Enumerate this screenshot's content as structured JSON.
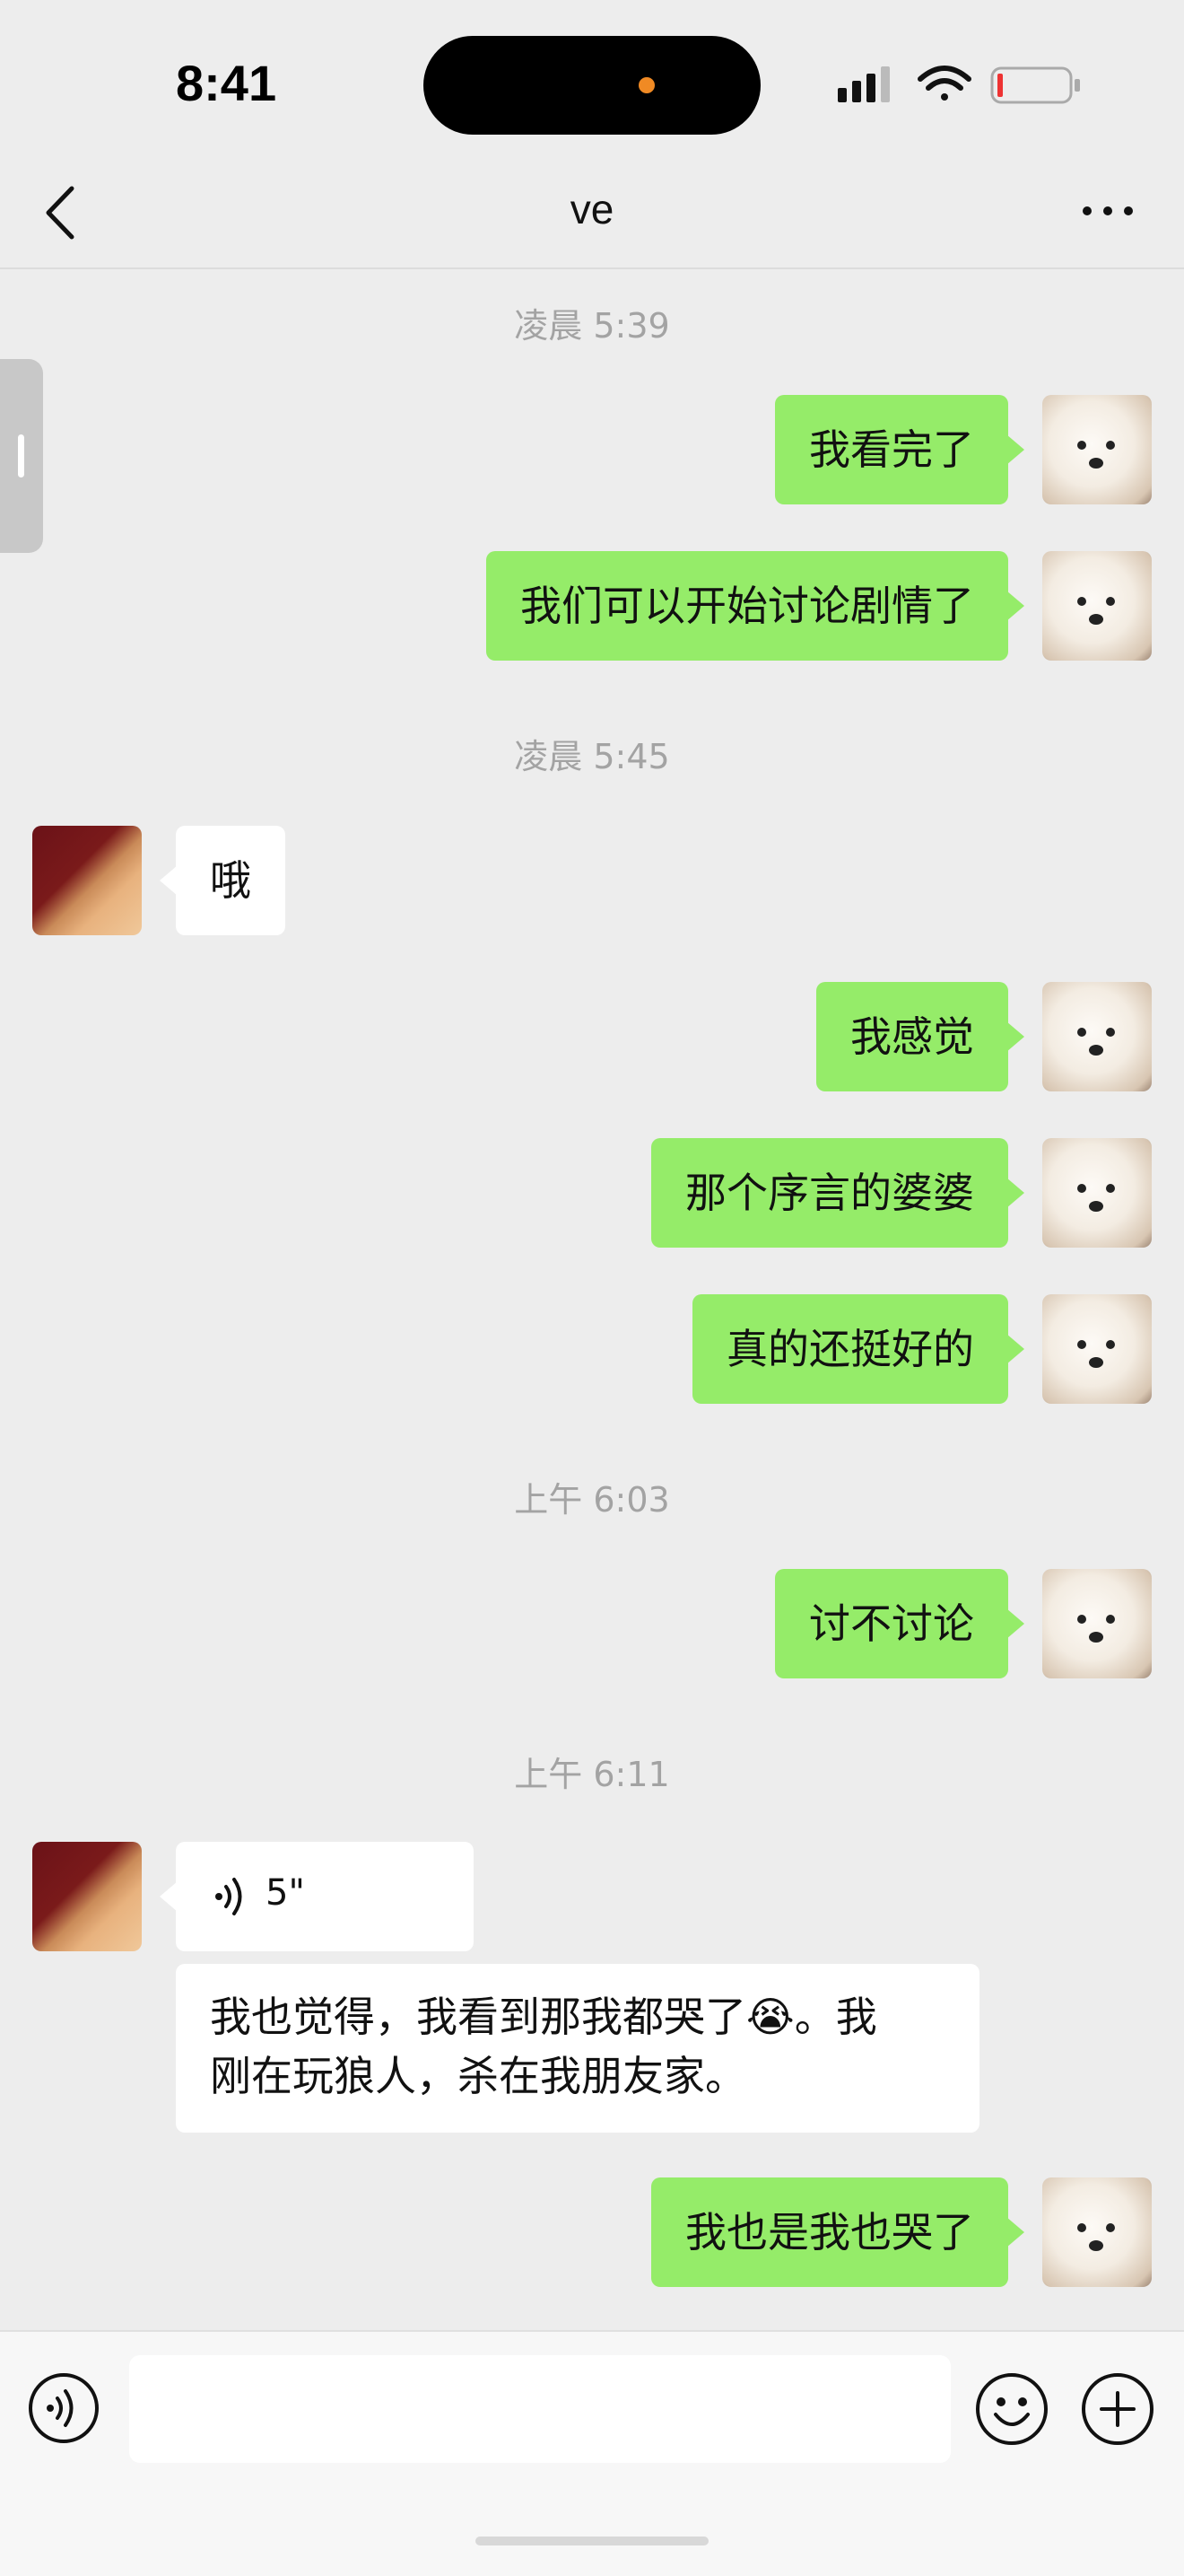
{
  "status_bar": {
    "time": "8:41"
  },
  "nav": {
    "title": "ve"
  },
  "messages": [
    {
      "type": "timestamp",
      "text": "凌晨 5:39"
    },
    {
      "type": "sent",
      "text": "我看完了"
    },
    {
      "type": "sent",
      "text": "我们可以开始讨论剧情了"
    },
    {
      "type": "timestamp",
      "text": "凌晨 5:45"
    },
    {
      "type": "received",
      "text": "哦"
    },
    {
      "type": "sent",
      "text": "我感觉"
    },
    {
      "type": "sent",
      "text": "那个序言的婆婆"
    },
    {
      "type": "sent",
      "text": "真的还挺好的"
    },
    {
      "type": "timestamp",
      "text": "上午 6:03"
    },
    {
      "type": "sent",
      "text": "讨不讨论"
    },
    {
      "type": "timestamp",
      "text": "上午 6:11"
    },
    {
      "type": "voice",
      "duration": "5\""
    },
    {
      "type": "received_transcript",
      "line1": "我也觉得，我看到那我都哭了😭。我",
      "line2": "刚在玩狼人，杀在我朋友家。"
    },
    {
      "type": "sent",
      "text": "我也是我也哭了"
    }
  ],
  "input_bar": {
    "message_value": ""
  },
  "icons": {
    "back": "chevron-left-icon",
    "more": "more-dots-icon",
    "voice_input": "voice-icon",
    "emoji": "smiley-icon",
    "plus": "plus-icon"
  },
  "colors": {
    "background": "#ededed",
    "sent_bubble": "#95ec69",
    "received_bubble": "#ffffff",
    "timestamp_text": "#a3a3a3"
  }
}
